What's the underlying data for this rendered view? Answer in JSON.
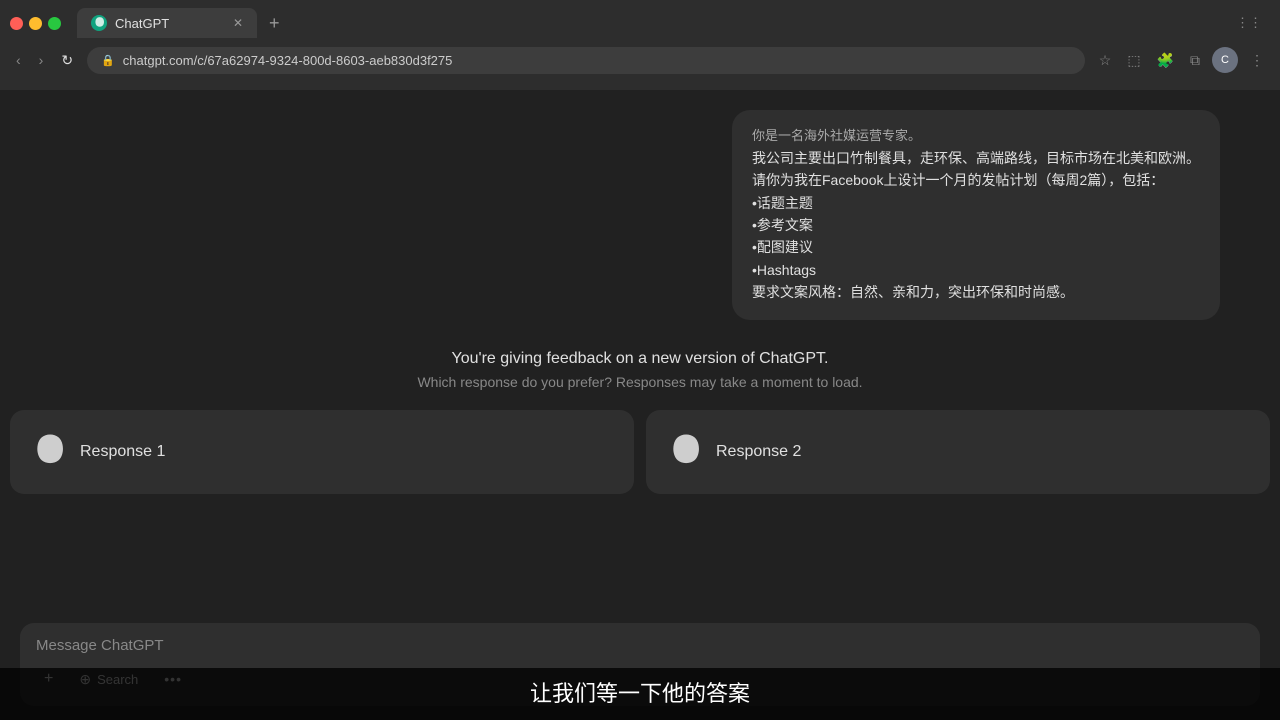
{
  "browser": {
    "tab_title": "ChatGPT",
    "url": "chatgpt.com/c/67a62974-9324-800d-8603-aeb830d3f275",
    "favicon_letter": "C"
  },
  "message": {
    "lines": [
      "你是一名海外社媒运营专家。",
      "我公司主要出口竹制餐具，走环保、高端路线，目标市场在北美和欧洲。",
      "请你为我在Facebook上设计一个月的发帖计划（每周2篇），包括：",
      "•话题主题",
      "•参考文案",
      "•配图建议",
      "•Hashtags",
      "要求文案风格：自然、亲和力，突出环保和时尚感。"
    ]
  },
  "feedback": {
    "title": "You're giving feedback on a new version of ChatGPT.",
    "subtitle": "Which response do you prefer? Responses may take a moment to load."
  },
  "responses": [
    {
      "label": "Response 1"
    },
    {
      "label": "Response 2"
    }
  ],
  "input": {
    "placeholder": "Message ChatGPT",
    "tools": [
      {
        "name": "plus",
        "symbol": "+",
        "label": ""
      },
      {
        "name": "search",
        "symbol": "⊕",
        "label": "Search"
      },
      {
        "name": "more",
        "symbol": "···",
        "label": ""
      }
    ]
  },
  "subtitle": {
    "text": "让我们等一下他的答案"
  }
}
